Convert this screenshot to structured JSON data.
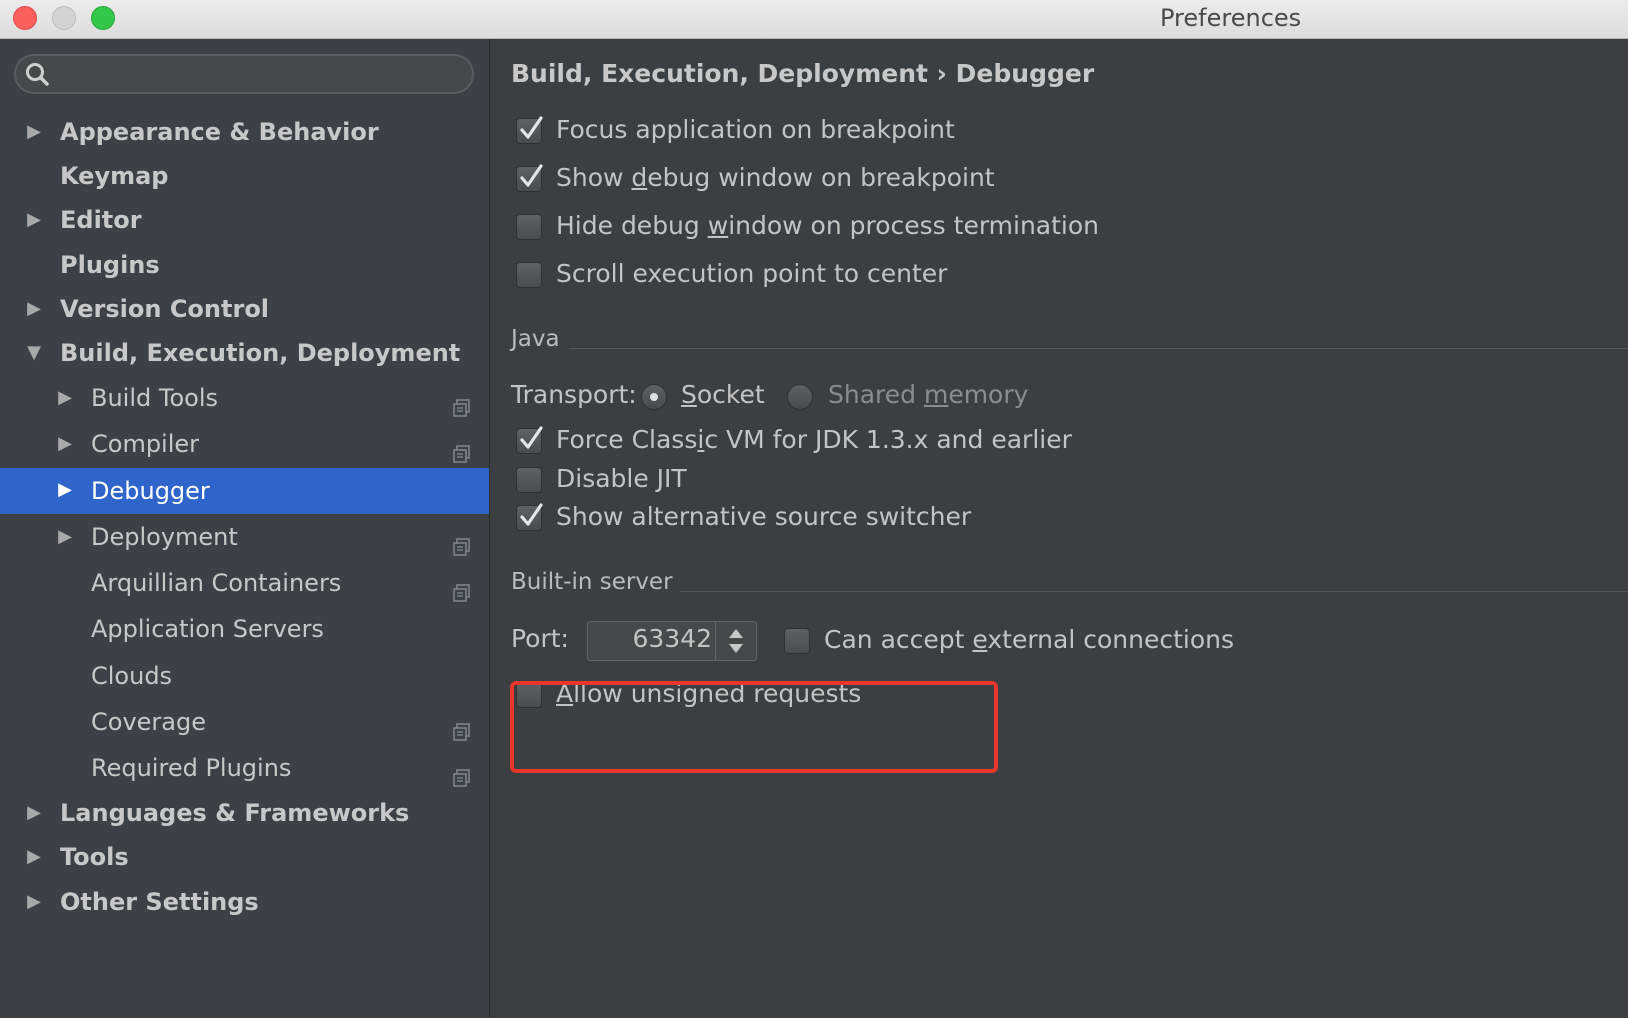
{
  "window": {
    "title": "Preferences"
  },
  "search": {
    "placeholder": ""
  },
  "sidebar": {
    "items": [
      {
        "label": "Appearance & Behavior",
        "level": 0,
        "arrow": "right"
      },
      {
        "label": "Keymap",
        "level": 0,
        "arrow": "none"
      },
      {
        "label": "Editor",
        "level": 0,
        "arrow": "right"
      },
      {
        "label": "Plugins",
        "level": 0,
        "arrow": "none"
      },
      {
        "label": "Version Control",
        "level": 0,
        "arrow": "right"
      },
      {
        "label": "Build, Execution, Deployment",
        "level": 0,
        "arrow": "down"
      },
      {
        "label": "Build Tools",
        "level": 1,
        "arrow": "right",
        "project_icon": true
      },
      {
        "label": "Compiler",
        "level": 1,
        "arrow": "right",
        "project_icon": true
      },
      {
        "label": "Debugger",
        "level": 1,
        "arrow": "right",
        "selected": true
      },
      {
        "label": "Deployment",
        "level": 1,
        "arrow": "right",
        "project_icon": true
      },
      {
        "label": "Arquillian Containers",
        "level": 1,
        "arrow": "none",
        "project_icon": true
      },
      {
        "label": "Application Servers",
        "level": 1,
        "arrow": "none"
      },
      {
        "label": "Clouds",
        "level": 1,
        "arrow": "none"
      },
      {
        "label": "Coverage",
        "level": 1,
        "arrow": "none",
        "project_icon": true
      },
      {
        "label": "Required Plugins",
        "level": 1,
        "arrow": "none",
        "project_icon": true
      },
      {
        "label": "Languages & Frameworks",
        "level": 0,
        "arrow": "right"
      },
      {
        "label": "Tools",
        "level": 0,
        "arrow": "right"
      },
      {
        "label": "Other Settings",
        "level": 0,
        "arrow": "right"
      }
    ]
  },
  "main": {
    "breadcrumb": "Build, Execution, Deployment › Debugger",
    "general": {
      "focus_app": {
        "label": "Focus application on breakpoint",
        "checked": true
      },
      "show_debug": {
        "pre": "Show ",
        "mn": "d",
        "post": "ebug window on breakpoint",
        "checked": true
      },
      "hide_debug": {
        "pre": "Hide debug ",
        "mn": "w",
        "post": "indow on process termination",
        "checked": false
      },
      "scroll_center": {
        "label": "Scroll execution point to center",
        "checked": false
      }
    },
    "java": {
      "title": "Java",
      "transport_label": "Transport:",
      "socket": {
        "mn": "S",
        "post": "ocket",
        "selected": true
      },
      "shared_memory": {
        "pre": "Shared ",
        "mn": "m",
        "post": "emory",
        "selected": false
      },
      "force_classic": {
        "pre": "Force Class",
        "mn": "i",
        "post": "c VM for JDK 1.3.x and earlier",
        "checked": true
      },
      "disable_jit": {
        "label": "Disable JIT",
        "checked": false
      },
      "alt_source": {
        "label": "Show alternative source switcher",
        "checked": true
      }
    },
    "server": {
      "title": "Built-in server",
      "port_label": "Port:",
      "port_value": "63342",
      "external": {
        "pre": "Can accept ",
        "mn": "e",
        "post": "xternal connections",
        "checked": false
      },
      "unsigned": {
        "mn": "A",
        "post": "llow unsigned requests",
        "checked": false
      }
    }
  },
  "colors": {
    "selection": "#2f65ca",
    "highlight": "#e8372a",
    "background": "#3c3f41"
  }
}
